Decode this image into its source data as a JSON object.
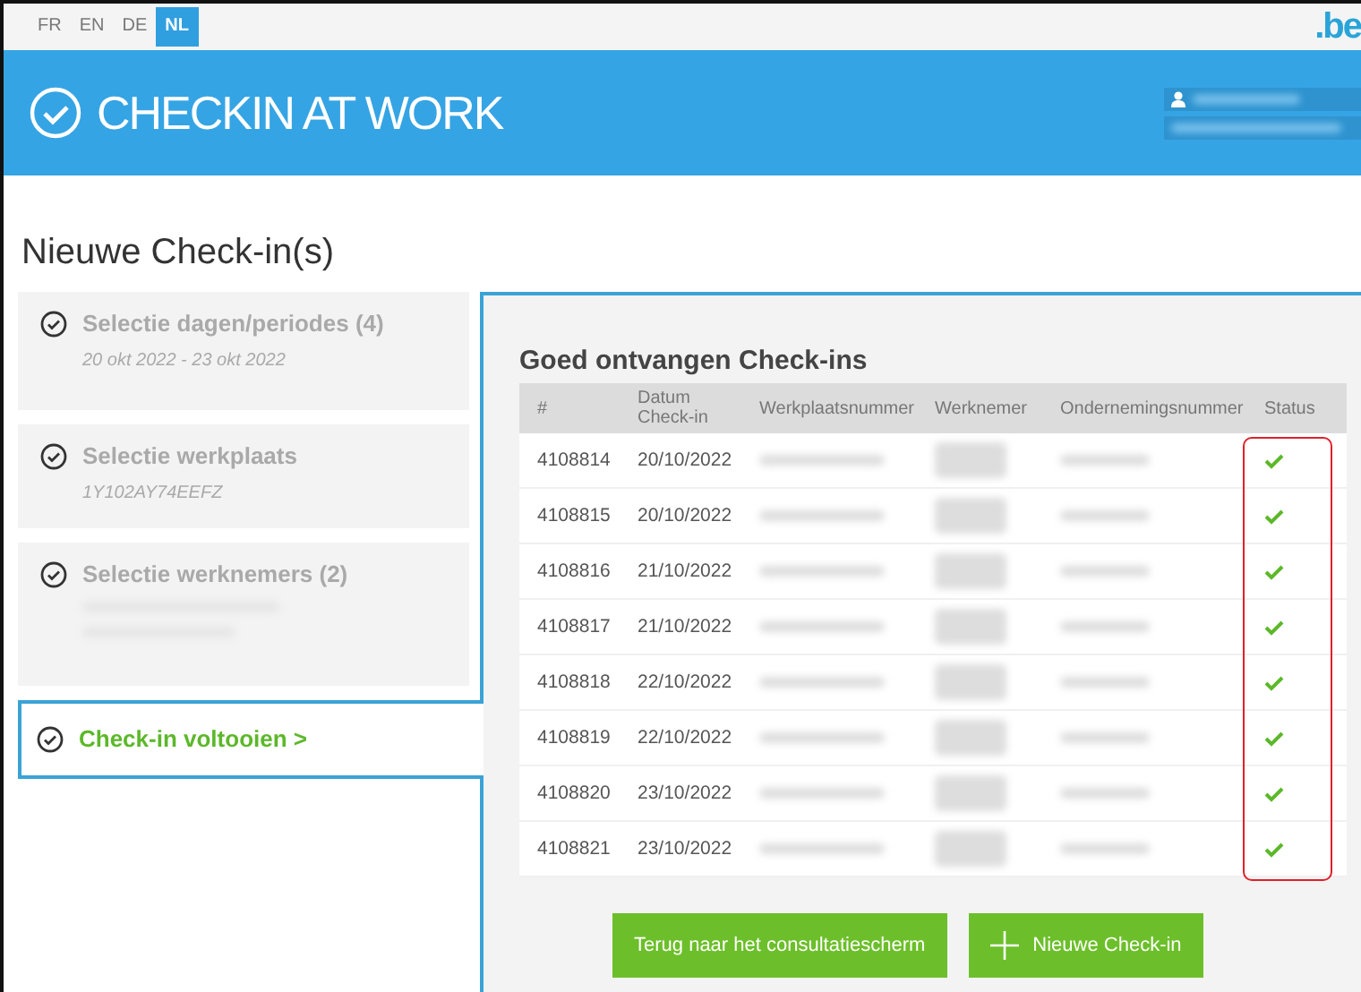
{
  "languages": [
    {
      "label": "FR",
      "selected": false
    },
    {
      "label": "EN",
      "selected": false
    },
    {
      "label": "DE",
      "selected": false
    },
    {
      "label": "NL",
      "selected": true
    }
  ],
  "domain_logo": ".be",
  "app_logo": {
    "light": "CHECK",
    "bold": "IN",
    "rest": "AT WORK"
  },
  "page_title": "Nieuwe Check-in(s)",
  "steps": [
    {
      "title": "Selectie dagen/periodes (4)",
      "subtitle": "20 okt 2022 - 23 okt 2022",
      "selected": false
    },
    {
      "title": "Selectie werkplaats",
      "subtitle": "1Y102AY74EEFZ",
      "selected": false
    },
    {
      "title": "Selectie werknemers  (2)",
      "selected": false
    },
    {
      "title": "Check-in voltooien >",
      "selected": true
    }
  ],
  "table": {
    "title": "Goed ontvangen Check-ins",
    "columns": [
      "#",
      "Datum Check-in",
      "Werkplaatsnummer",
      "Werknemer",
      "Ondernemingsnummer",
      "Status"
    ],
    "rows": [
      {
        "id": "4108814",
        "date": "20/10/2022",
        "ok": true
      },
      {
        "id": "4108815",
        "date": "20/10/2022",
        "ok": true
      },
      {
        "id": "4108816",
        "date": "21/10/2022",
        "ok": true
      },
      {
        "id": "4108817",
        "date": "21/10/2022",
        "ok": true
      },
      {
        "id": "4108818",
        "date": "22/10/2022",
        "ok": true
      },
      {
        "id": "4108819",
        "date": "22/10/2022",
        "ok": true
      },
      {
        "id": "4108820",
        "date": "23/10/2022",
        "ok": true
      },
      {
        "id": "4108821",
        "date": "23/10/2022",
        "ok": true
      }
    ]
  },
  "buttons": [
    {
      "label": "Terug naar het consultatiescherm",
      "kind": "plain"
    },
    {
      "label": "Nieuwe Check-in",
      "kind": "add"
    }
  ]
}
